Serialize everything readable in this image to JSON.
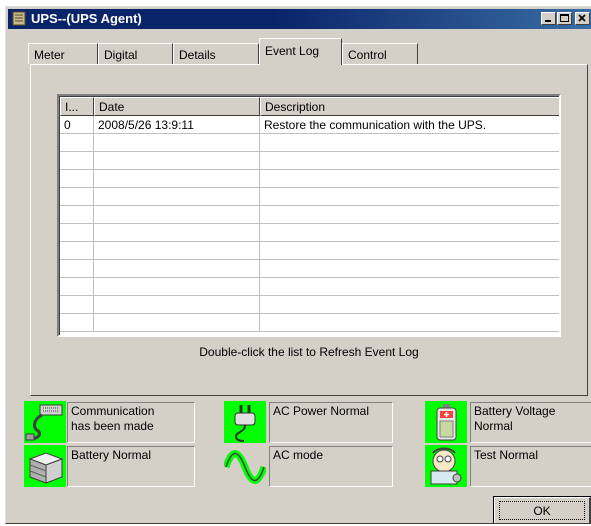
{
  "window": {
    "title": "UPS--(UPS Agent)"
  },
  "tabs": [
    {
      "label": "Meter"
    },
    {
      "label": "Digital"
    },
    {
      "label": "Details"
    },
    {
      "label": "Event Log",
      "active": true
    },
    {
      "label": "Control"
    }
  ],
  "event_log": {
    "columns": [
      "I...",
      "Date",
      "Description"
    ],
    "rows": [
      {
        "index": "0",
        "date": "2008/5/26 13:9:11",
        "description": "Restore the communication with the UPS."
      }
    ],
    "hint": "Double-click the list to Refresh Event Log"
  },
  "status": {
    "icon_background": "#00ff00",
    "items": [
      {
        "icon": "cable-icon",
        "text": "Communication\nhas been made"
      },
      {
        "icon": "power-plug-icon",
        "text": "AC Power Normal"
      },
      {
        "icon": "battery-icon",
        "text": "Battery Voltage\nNormal"
      },
      {
        "icon": "battery-pack-icon",
        "text": "Battery Normal"
      },
      {
        "icon": "sine-wave-icon",
        "text": "AC mode"
      },
      {
        "icon": "test-doctor-icon",
        "text": "Test Normal"
      }
    ]
  },
  "buttons": {
    "ok_label": "OK"
  }
}
